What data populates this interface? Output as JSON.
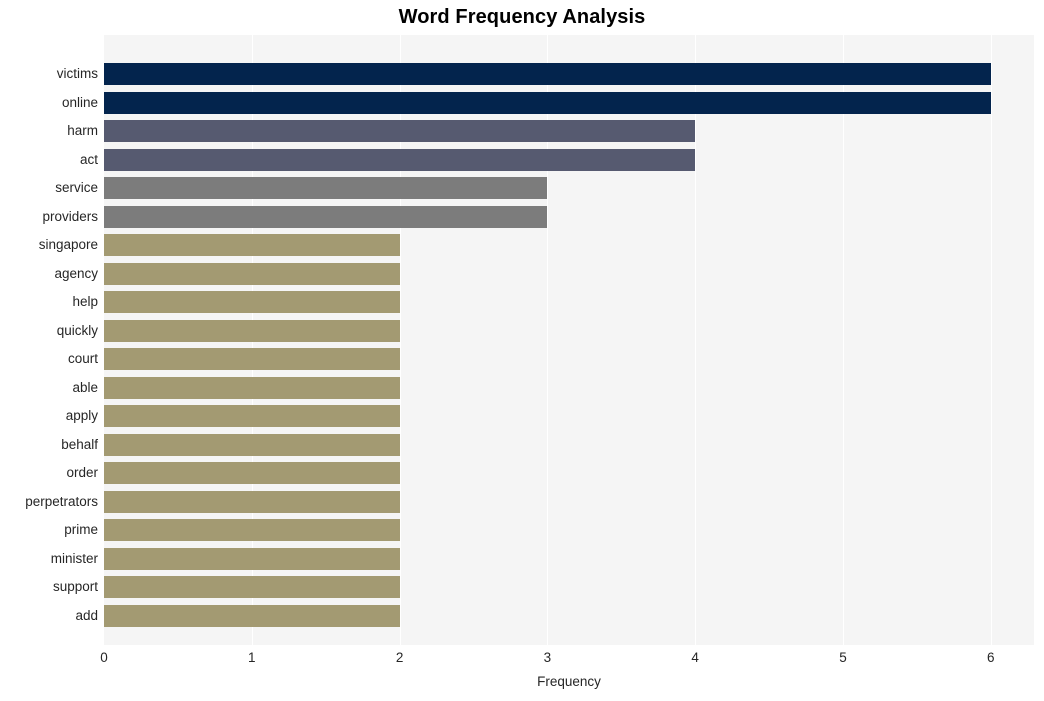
{
  "chart_data": {
    "type": "bar",
    "orientation": "horizontal",
    "title": "Word Frequency Analysis",
    "xlabel": "Frequency",
    "ylabel": "",
    "xlim": [
      0,
      6
    ],
    "xticks": [
      "0",
      "1",
      "2",
      "3",
      "4",
      "5",
      "6"
    ],
    "grid": true,
    "legend": false,
    "categories": [
      "victims",
      "online",
      "harm",
      "act",
      "service",
      "providers",
      "singapore",
      "agency",
      "help",
      "quickly",
      "court",
      "able",
      "apply",
      "behalf",
      "order",
      "perpetrators",
      "prime",
      "minister",
      "support",
      "add"
    ],
    "values": [
      6,
      6,
      4,
      4,
      3,
      3,
      2,
      2,
      2,
      2,
      2,
      2,
      2,
      2,
      2,
      2,
      2,
      2,
      2,
      2
    ],
    "bar_colors": [
      "#03244d",
      "#03244d",
      "#565a70",
      "#565a70",
      "#7c7c7c",
      "#7c7c7c",
      "#a39a72",
      "#a39a72",
      "#a39a72",
      "#a39a72",
      "#a39a72",
      "#a39a72",
      "#a39a72",
      "#a39a72",
      "#a39a72",
      "#a39a72",
      "#a39a72",
      "#a39a72",
      "#a39a72",
      "#a39a72"
    ]
  },
  "style": {
    "plot_background": "#f5f5f5",
    "page_background": "#ffffff",
    "gridline_color": "#ffffff",
    "text_color": "#262626",
    "title_color": "#000000"
  }
}
